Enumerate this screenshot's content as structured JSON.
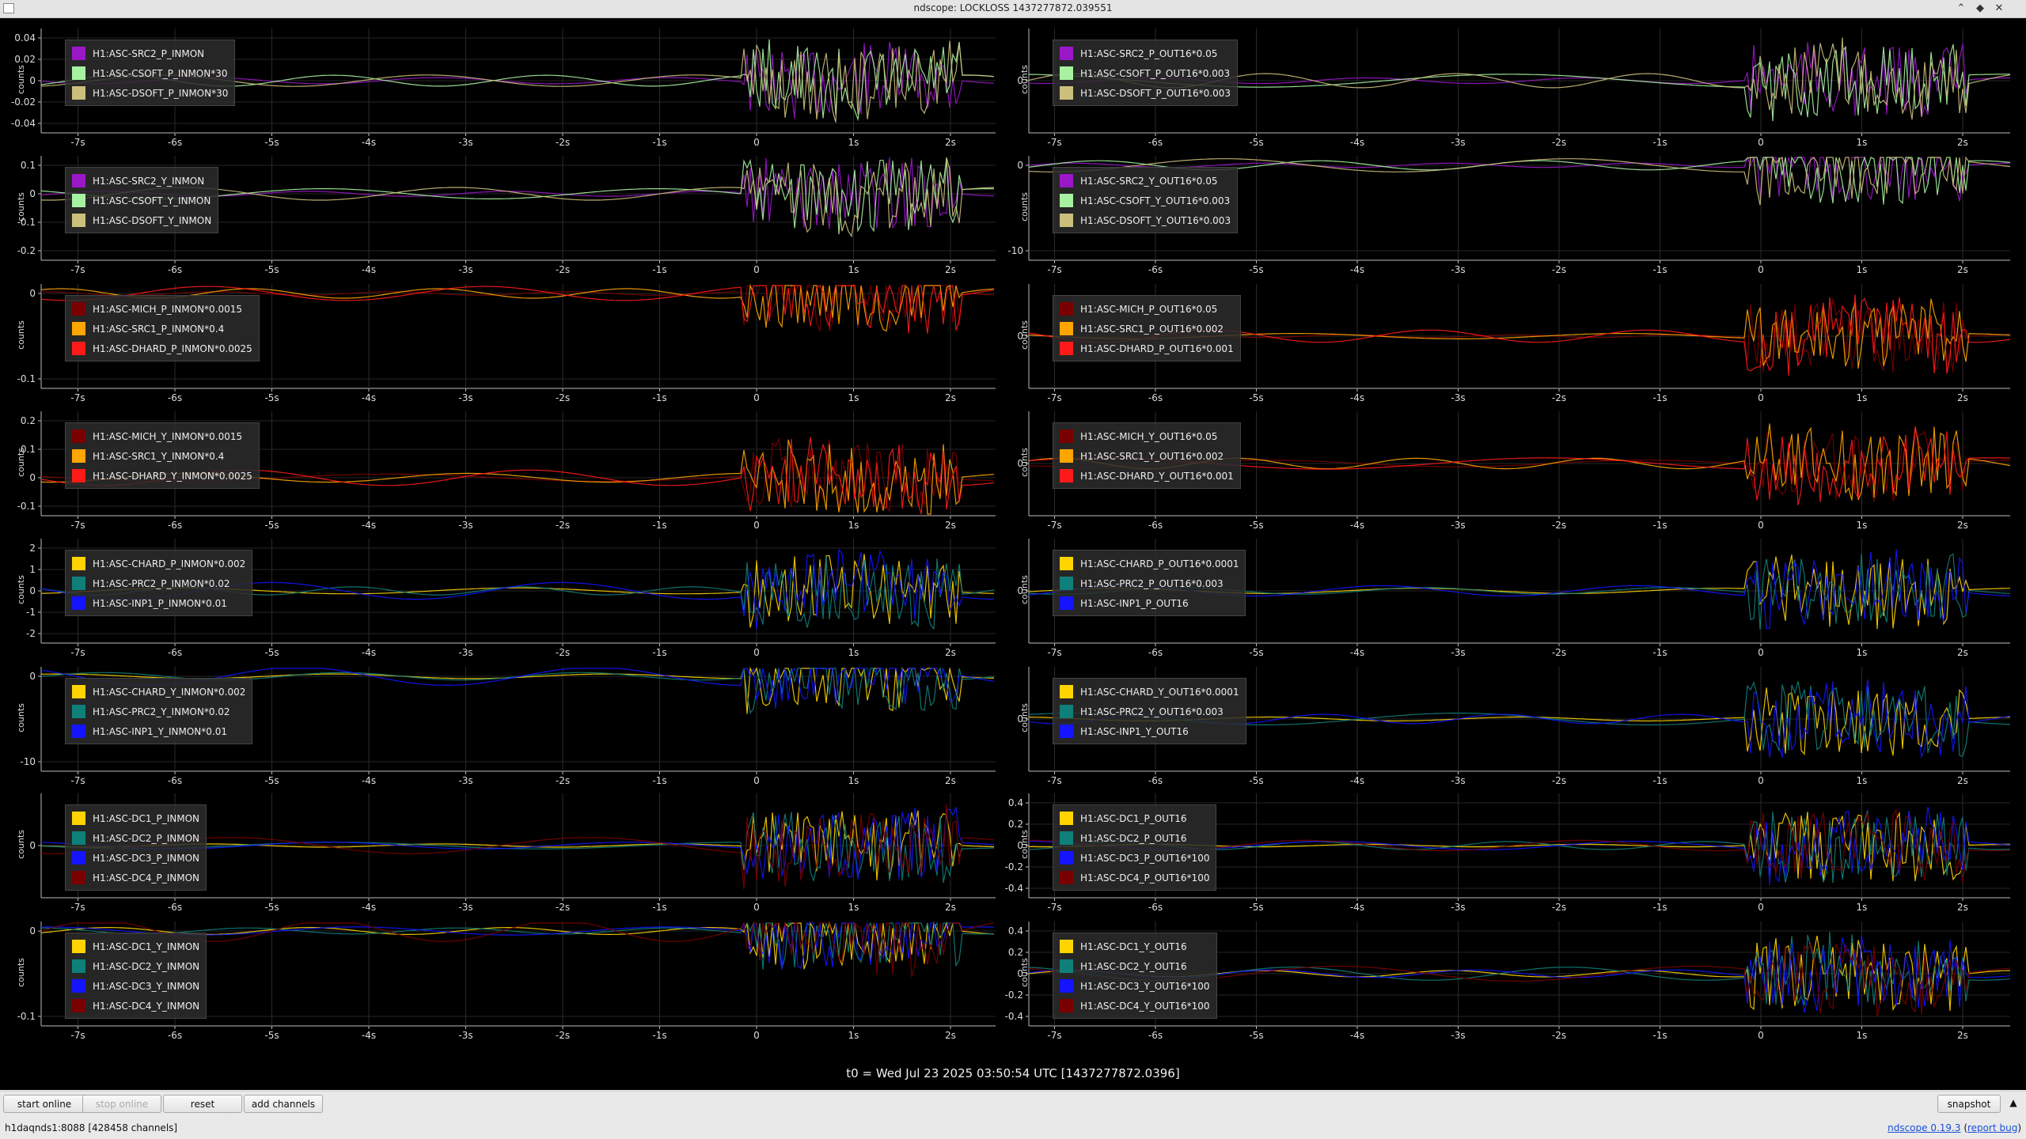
{
  "window": {
    "title": "ndscope: LOCKLOSS 1437277872.039551"
  },
  "colors": {
    "purple": "#9a17c8",
    "lightgreen": "#a6f2a0",
    "khaki": "#cbbf7c",
    "darkred": "#7a0000",
    "orange": "#ffa500",
    "red": "#ff1a1a",
    "yellow": "#ffd400",
    "teal": "#0f7f7a",
    "blue": "#1414ff"
  },
  "xaxis_ticks": [
    "-7s",
    "-6s",
    "-5s",
    "-4s",
    "-3s",
    "-2s",
    "-1s",
    "0",
    "1s",
    "2s"
  ],
  "plots": [
    {
      "id": "r1l",
      "ylabel": "counts",
      "yticks": [
        "0.04",
        "0.02",
        "0",
        "-0.02",
        "-0.04"
      ],
      "legend": [
        {
          "label": "H1:ASC-SRC2_P_INMON",
          "color": "#9a17c8"
        },
        {
          "label": "H1:ASC-CSOFT_P_INMON*30",
          "color": "#a6f2a0"
        },
        {
          "label": "H1:ASC-DSOFT_P_INMON*30",
          "color": "#cbbf7c"
        }
      ]
    },
    {
      "id": "r1r",
      "ylabel": "counts",
      "yticks": [
        "0"
      ],
      "legend": [
        {
          "label": "H1:ASC-SRC2_P_OUT16*0.05",
          "color": "#9a17c8"
        },
        {
          "label": "H1:ASC-CSOFT_P_OUT16*0.003",
          "color": "#a6f2a0"
        },
        {
          "label": "H1:ASC-DSOFT_P_OUT16*0.003",
          "color": "#cbbf7c"
        }
      ]
    },
    {
      "id": "r2l",
      "ylabel": "counts",
      "yticks": [
        "0.1",
        "0",
        "-0.1",
        "-0.2"
      ],
      "legend": [
        {
          "label": "H1:ASC-SRC2_Y_INMON",
          "color": "#9a17c8"
        },
        {
          "label": "H1:ASC-CSOFT_Y_INMON",
          "color": "#a6f2a0"
        },
        {
          "label": "H1:ASC-DSOFT_Y_INMON",
          "color": "#cbbf7c"
        }
      ]
    },
    {
      "id": "r2r",
      "ylabel": "counts",
      "yticks": [
        "0",
        "-10"
      ],
      "legend": [
        {
          "label": "H1:ASC-SRC2_Y_OUT16*0.05",
          "color": "#9a17c8"
        },
        {
          "label": "H1:ASC-CSOFT_Y_OUT16*0.003",
          "color": "#a6f2a0"
        },
        {
          "label": "H1:ASC-DSOFT_Y_OUT16*0.003",
          "color": "#cbbf7c"
        }
      ]
    },
    {
      "id": "r3l",
      "ylabel": "counts",
      "yticks": [
        "0",
        "-0.1"
      ],
      "legend": [
        {
          "label": "H1:ASC-MICH_P_INMON*0.0015",
          "color": "#7a0000"
        },
        {
          "label": "H1:ASC-SRC1_P_INMON*0.4",
          "color": "#ffa500"
        },
        {
          "label": "H1:ASC-DHARD_P_INMON*0.0025",
          "color": "#ff1a1a"
        }
      ]
    },
    {
      "id": "r3r",
      "ylabel": "counts",
      "yticks": [
        "0"
      ],
      "legend": [
        {
          "label": "H1:ASC-MICH_P_OUT16*0.05",
          "color": "#7a0000"
        },
        {
          "label": "H1:ASC-SRC1_P_OUT16*0.002",
          "color": "#ffa500"
        },
        {
          "label": "H1:ASC-DHARD_P_OUT16*0.001",
          "color": "#ff1a1a"
        }
      ]
    },
    {
      "id": "r4l",
      "ylabel": "counts",
      "yticks": [
        "0.2",
        "0.1",
        "0",
        "-0.1"
      ],
      "legend": [
        {
          "label": "H1:ASC-MICH_Y_INMON*0.0015",
          "color": "#7a0000"
        },
        {
          "label": "H1:ASC-SRC1_Y_INMON*0.4",
          "color": "#ffa500"
        },
        {
          "label": "H1:ASC-DHARD_Y_INMON*0.0025",
          "color": "#ff1a1a"
        }
      ]
    },
    {
      "id": "r4r",
      "ylabel": "counts",
      "yticks": [
        "0"
      ],
      "legend": [
        {
          "label": "H1:ASC-MICH_Y_OUT16*0.05",
          "color": "#7a0000"
        },
        {
          "label": "H1:ASC-SRC1_Y_OUT16*0.002",
          "color": "#ffa500"
        },
        {
          "label": "H1:ASC-DHARD_Y_OUT16*0.001",
          "color": "#ff1a1a"
        }
      ]
    },
    {
      "id": "r5l",
      "ylabel": "counts",
      "yticks": [
        "2",
        "1",
        "0",
        "-1",
        "-2"
      ],
      "legend": [
        {
          "label": "H1:ASC-CHARD_P_INMON*0.002",
          "color": "#ffd400"
        },
        {
          "label": "H1:ASC-PRC2_P_INMON*0.02",
          "color": "#0f7f7a"
        },
        {
          "label": "H1:ASC-INP1_P_INMON*0.01",
          "color": "#1414ff"
        }
      ]
    },
    {
      "id": "r5r",
      "ylabel": "counts",
      "yticks": [
        "0"
      ],
      "legend": [
        {
          "label": "H1:ASC-CHARD_P_OUT16*0.0001",
          "color": "#ffd400"
        },
        {
          "label": "H1:ASC-PRC2_P_OUT16*0.003",
          "color": "#0f7f7a"
        },
        {
          "label": "H1:ASC-INP1_P_OUT16",
          "color": "#1414ff"
        }
      ]
    },
    {
      "id": "r6l",
      "ylabel": "counts",
      "yticks": [
        "0",
        "-10"
      ],
      "legend": [
        {
          "label": "H1:ASC-CHARD_Y_INMON*0.002",
          "color": "#ffd400"
        },
        {
          "label": "H1:ASC-PRC2_Y_INMON*0.02",
          "color": "#0f7f7a"
        },
        {
          "label": "H1:ASC-INP1_Y_INMON*0.01",
          "color": "#1414ff"
        }
      ]
    },
    {
      "id": "r6r",
      "ylabel": "counts",
      "yticks": [
        "0"
      ],
      "legend": [
        {
          "label": "H1:ASC-CHARD_Y_OUT16*0.0001",
          "color": "#ffd400"
        },
        {
          "label": "H1:ASC-PRC2_Y_OUT16*0.003",
          "color": "#0f7f7a"
        },
        {
          "label": "H1:ASC-INP1_Y_OUT16",
          "color": "#1414ff"
        }
      ]
    },
    {
      "id": "r7l",
      "ylabel": "counts",
      "yticks": [
        "0"
      ],
      "legend": [
        {
          "label": "H1:ASC-DC1_P_INMON",
          "color": "#ffd400"
        },
        {
          "label": "H1:ASC-DC2_P_INMON",
          "color": "#0f7f7a"
        },
        {
          "label": "H1:ASC-DC3_P_INMON",
          "color": "#1414ff"
        },
        {
          "label": "H1:ASC-DC4_P_INMON",
          "color": "#7a0000"
        }
      ]
    },
    {
      "id": "r7r",
      "ylabel": "counts",
      "yticks": [
        "0.4",
        "0.2",
        "0",
        "-0.2",
        "-0.4"
      ],
      "legend": [
        {
          "label": "H1:ASC-DC1_P_OUT16",
          "color": "#ffd400"
        },
        {
          "label": "H1:ASC-DC2_P_OUT16",
          "color": "#0f7f7a"
        },
        {
          "label": "H1:ASC-DC3_P_OUT16*100",
          "color": "#1414ff"
        },
        {
          "label": "H1:ASC-DC4_P_OUT16*100",
          "color": "#7a0000"
        }
      ]
    },
    {
      "id": "r8l",
      "ylabel": "counts",
      "yticks": [
        "0",
        "-0.1"
      ],
      "legend": [
        {
          "label": "H1:ASC-DC1_Y_INMON",
          "color": "#ffd400"
        },
        {
          "label": "H1:ASC-DC2_Y_INMON",
          "color": "#0f7f7a"
        },
        {
          "label": "H1:ASC-DC3_Y_INMON",
          "color": "#1414ff"
        },
        {
          "label": "H1:ASC-DC4_Y_INMON",
          "color": "#7a0000"
        }
      ]
    },
    {
      "id": "r8r",
      "ylabel": "counts",
      "yticks": [
        "0.4",
        "0.2",
        "0",
        "-0.2",
        "-0.4"
      ],
      "legend": [
        {
          "label": "H1:ASC-DC1_Y_OUT16",
          "color": "#ffd400"
        },
        {
          "label": "H1:ASC-DC2_Y_OUT16",
          "color": "#0f7f7a"
        },
        {
          "label": "H1:ASC-DC3_Y_OUT16*100",
          "color": "#1414ff"
        },
        {
          "label": "H1:ASC-DC4_Y_OUT16*100",
          "color": "#7a0000"
        }
      ]
    }
  ],
  "t0_label": "t0 = Wed Jul 23 2025 03:50:54 UTC [1437277872.0396]",
  "toolbar": {
    "start_online": "start online",
    "stop_online": "stop online",
    "reset": "reset",
    "add_channels": "add channels",
    "snapshot": "snapshot"
  },
  "status": {
    "server": "h1daqnds1:8088",
    "channels": "[428458 channels]",
    "version_link": "ndscope 0.19.3",
    "report_bug": "report bug"
  }
}
